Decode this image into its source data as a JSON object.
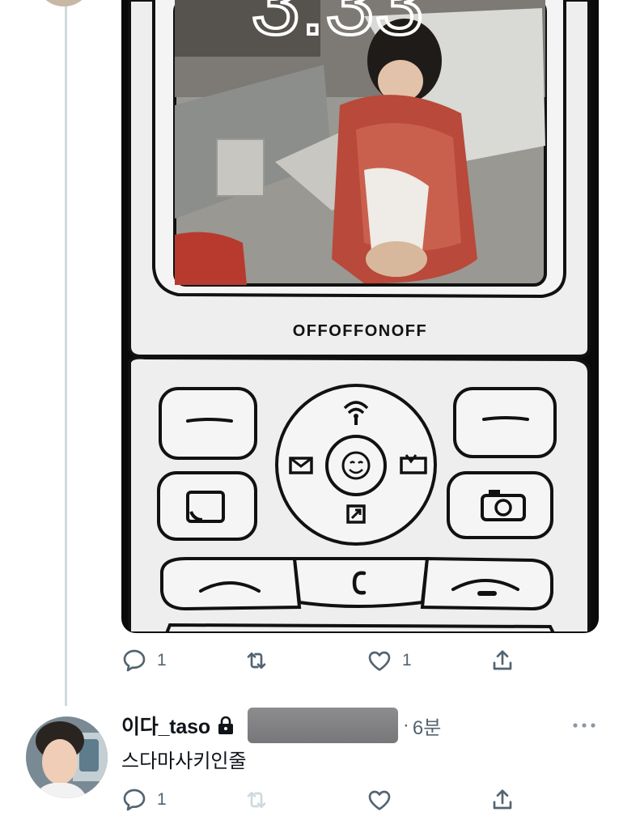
{
  "thread": {
    "media": {
      "clock_text": "3:33",
      "brand_text": "OFFOFFONOFF",
      "description_icon": "phone-illustration"
    },
    "post_actions": {
      "reply_count": "1",
      "retweet_count": "",
      "like_count": "1"
    }
  },
  "reply": {
    "username": "이다_taso",
    "protected_icon": "lock-icon",
    "separator": "·",
    "time": "6분",
    "text": "스다마사키인줄",
    "actions": {
      "reply_count": "1",
      "retweet_count": "",
      "like_count": ""
    }
  },
  "colors": {
    "icon_gray": "#536471",
    "thread_line": "#cfd9de",
    "text_primary": "#0f1419"
  }
}
